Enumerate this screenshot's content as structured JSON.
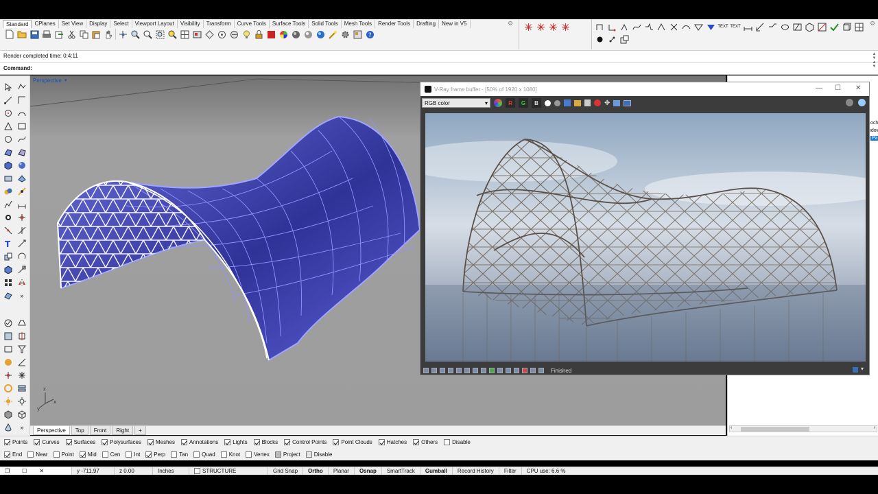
{
  "toolbar": {
    "tabs": [
      "Standard",
      "CPlanes",
      "Set View",
      "Display",
      "Select",
      "Viewport Layout",
      "Visibility",
      "Transform",
      "Curve Tools",
      "Surface Tools",
      "Solid Tools",
      "Mesh Tools",
      "Render Tools",
      "Drafting",
      "New in V5"
    ],
    "right_labels": {
      "text1": "TEXT",
      "text2": "TEXT"
    }
  },
  "command_history": "Render completed time: 0:4:11",
  "command_prompt": "Command:",
  "viewport": {
    "title": "Perspective",
    "axis_labels": {
      "x": "x",
      "y": "y",
      "z": "z"
    }
  },
  "viewport_tabs": [
    "Perspective",
    "Top",
    "Front",
    "Right"
  ],
  "right_panel_fragments": {
    "a": "och",
    "b": "ndow",
    "c": "Pa"
  },
  "vray": {
    "title": "V-Ray frame buffer - [50% of 1920 x 1080]",
    "channel_select": "RGB color",
    "channels": [
      "R",
      "G",
      "B"
    ],
    "status": "Finished"
  },
  "layer_filters": [
    {
      "label": "Points",
      "checked": true
    },
    {
      "label": "Curves",
      "checked": true
    },
    {
      "label": "Surfaces",
      "checked": true
    },
    {
      "label": "Polysurfaces",
      "checked": true
    },
    {
      "label": "Meshes",
      "checked": true
    },
    {
      "label": "Annotations",
      "checked": true
    },
    {
      "label": "Lights",
      "checked": true
    },
    {
      "label": "Blocks",
      "checked": true
    },
    {
      "label": "Control Points",
      "checked": true
    },
    {
      "label": "Point Clouds",
      "checked": true
    },
    {
      "label": "Hatches",
      "checked": true
    },
    {
      "label": "Others",
      "checked": true
    },
    {
      "label": "Disable",
      "checked": false
    }
  ],
  "osnaps": [
    {
      "label": "End",
      "checked": true
    },
    {
      "label": "Near",
      "checked": false
    },
    {
      "label": "Point",
      "checked": false
    },
    {
      "label": "Mid",
      "checked": true
    },
    {
      "label": "Cen",
      "checked": false
    },
    {
      "label": "Int",
      "checked": false
    },
    {
      "label": "Perp",
      "checked": true
    },
    {
      "label": "Tan",
      "checked": false
    },
    {
      "label": "Quad",
      "checked": false
    },
    {
      "label": "Knot",
      "checked": false
    },
    {
      "label": "Vertex",
      "checked": false
    },
    {
      "label": "Project",
      "checked": false
    },
    {
      "label": "Disable",
      "checked": false
    }
  ],
  "status": {
    "y": "y -711.97",
    "z": "z 0.00",
    "units": "Inches",
    "layer": "STRUCTURE",
    "grid_snap": "Grid Snap",
    "ortho": "Ortho",
    "planar": "Planar",
    "osnap": "Osnap",
    "smarttrack": "SmartTrack",
    "gumball": "Gumball",
    "record_history": "Record History",
    "filter": "Filter",
    "cpu": "CPU use: 6.6 %"
  },
  "colors": {
    "surface": "#5b5fd6",
    "viewport_bg": "#9d9d9d",
    "vray_bg": "#3c3c3c",
    "accent": "#1452b8"
  }
}
